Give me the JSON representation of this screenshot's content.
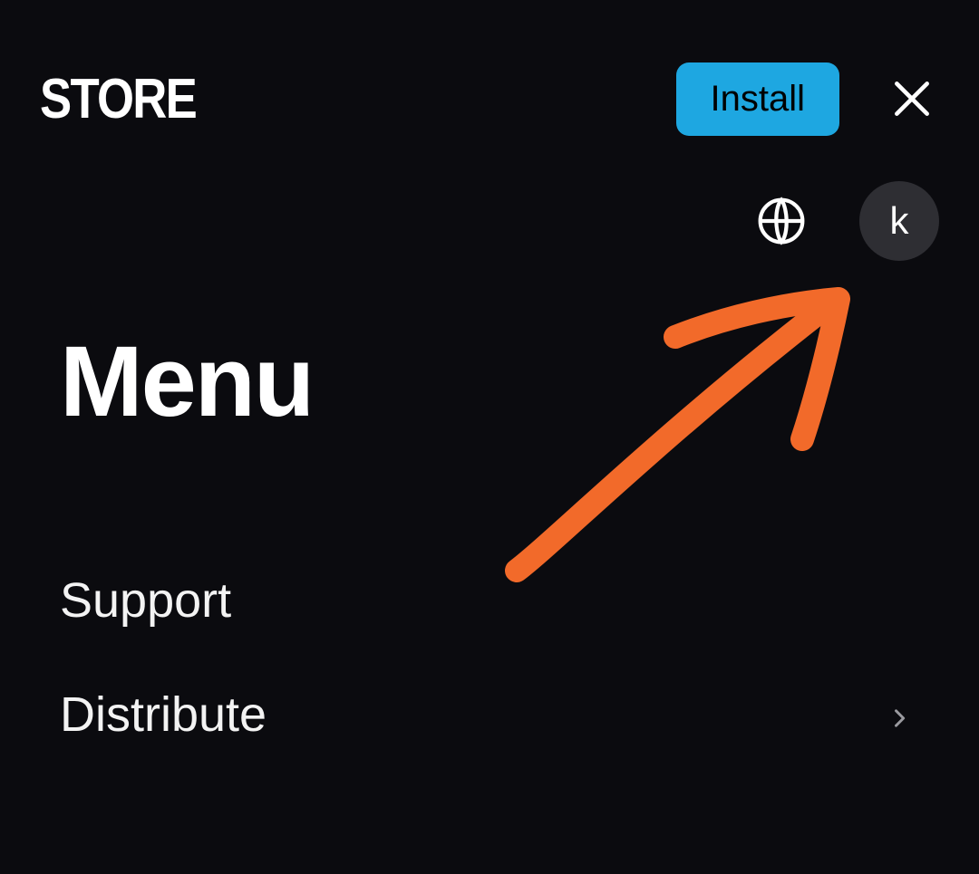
{
  "header": {
    "logo": "STORE",
    "install_label": "Install"
  },
  "subheader": {
    "avatar_letter": "k"
  },
  "menu": {
    "title": "Menu",
    "items": [
      {
        "label": "Support",
        "has_children": false
      },
      {
        "label": "Distribute",
        "has_children": true
      }
    ]
  },
  "annotation": {
    "type": "hand-drawn-arrow",
    "color": "#f26a2a"
  }
}
